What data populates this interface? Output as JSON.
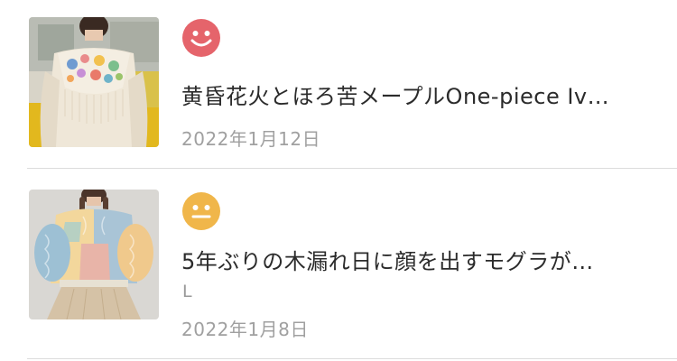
{
  "items": [
    {
      "title": "黄昏花火とほろ苦メープルOne-piece Iv…",
      "date": "2022年1月12日",
      "rating_icon": "smile-face-icon",
      "rating_color": "#e5646b",
      "thumbnail": "knit-lace-blouse-photo"
    },
    {
      "title": "5年ぶりの木漏れ日に顔を出すモグラが…",
      "size": "L",
      "date": "2022年1月8日",
      "rating_icon": "neutral-face-icon",
      "rating_color": "#f0b64a",
      "thumbnail": "patchwork-knit-sweater-photo"
    }
  ]
}
